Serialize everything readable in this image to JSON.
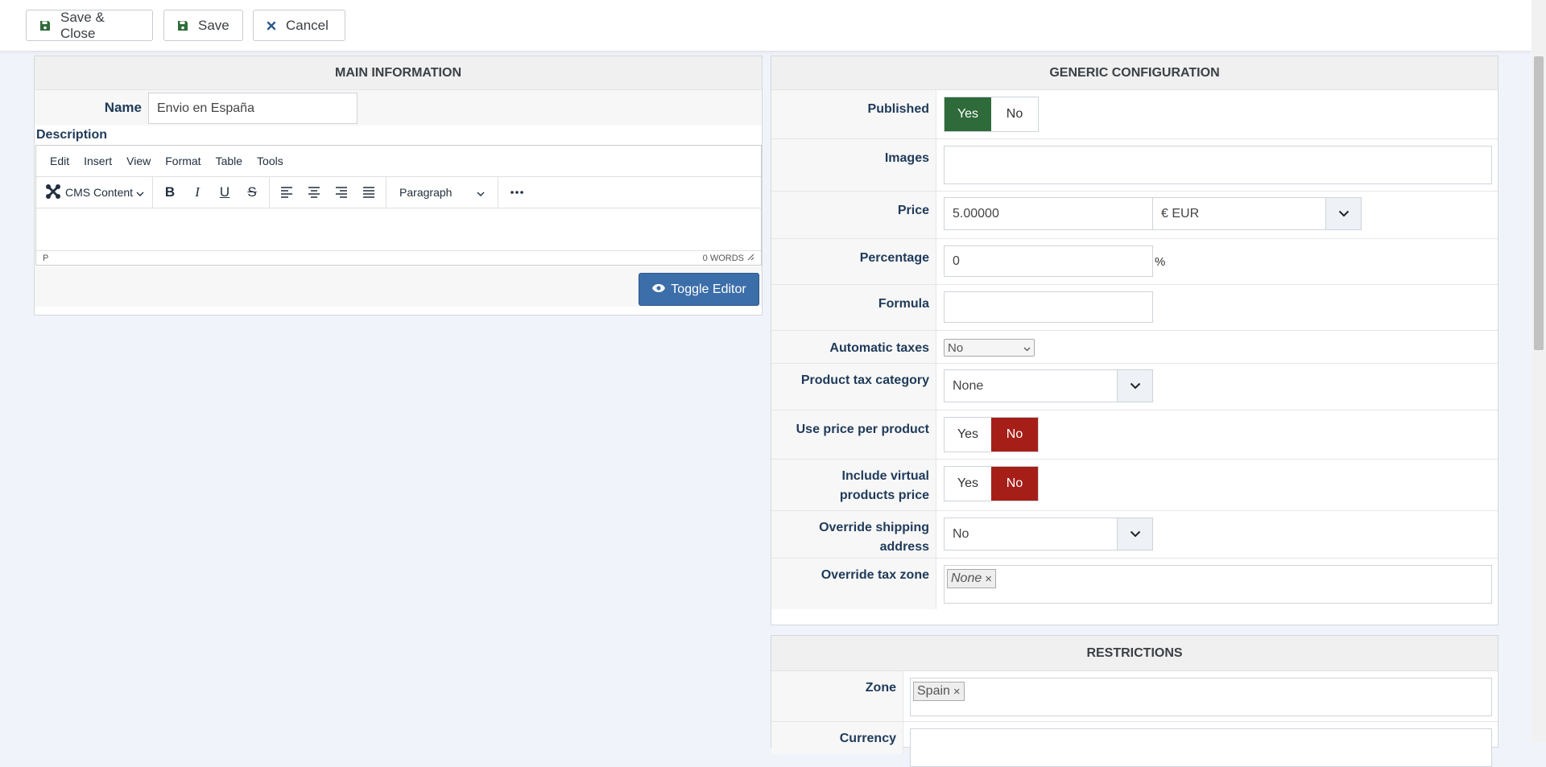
{
  "toolbar": {
    "save_close": "Save & Close",
    "save": "Save",
    "cancel": "Cancel"
  },
  "main_info": {
    "title": "MAIN INFORMATION",
    "name_label": "Name",
    "name_value": "Envio en España",
    "description_label": "Description",
    "menu": [
      "Edit",
      "Insert",
      "View",
      "Format",
      "Table",
      "Tools"
    ],
    "cms_content": "CMS Content",
    "paragraph": "Paragraph",
    "status_path": "P",
    "word_count": "0 WORDS",
    "toggle_editor": "Toggle Editor"
  },
  "generic": {
    "title": "GENERIC CONFIGURATION",
    "published_label": "Published",
    "yes": "Yes",
    "no": "No",
    "images_label": "Images",
    "price_label": "Price",
    "price_value": "5.00000",
    "currency_value": "€ EUR",
    "percentage_label": "Percentage",
    "percentage_value": "0",
    "percent_sign": "%",
    "formula_label": "Formula",
    "auto_taxes_label": "Automatic taxes",
    "auto_taxes_value": "No",
    "tax_category_label": "Product tax category",
    "tax_category_value": "None",
    "price_per_product_label": "Use price per product",
    "virtual_label_1": "Include virtual",
    "virtual_label_2": "products price",
    "override_address_label": "Override shipping address",
    "override_address_value": "No",
    "override_zone_label": "Override tax zone",
    "override_zone_chip": "None"
  },
  "restrictions": {
    "title": "RESTRICTIONS",
    "zone_label": "Zone",
    "zone_chip": "Spain",
    "currency_label": "Currency"
  },
  "colors": {
    "yes_active": "#2f6b3a",
    "no_active": "#a51f18",
    "toggle_editor": "#3c6ea9"
  }
}
